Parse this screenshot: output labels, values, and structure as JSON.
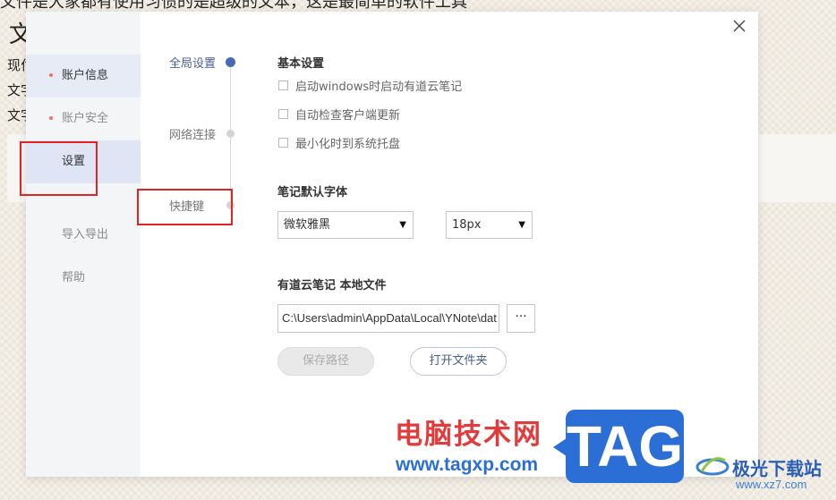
{
  "background": {
    "top_text": "文件是大家都有使用习惯的是超级的文本，这是最简单的软件工具",
    "heading": "文",
    "lines": [
      "现付",
      "文字",
      "文字"
    ]
  },
  "sidebar": {
    "items": [
      {
        "label": "账户信息"
      },
      {
        "label": "账户安全"
      },
      {
        "label": "设置"
      },
      {
        "label": "导入导出"
      },
      {
        "label": "帮助"
      }
    ]
  },
  "settings_nav": {
    "items": [
      {
        "label": "全局设置"
      },
      {
        "label": "网络连接"
      },
      {
        "label": "快捷键"
      }
    ]
  },
  "basic": {
    "title": "基本设置",
    "options": [
      {
        "label": "启动windows时启动有道云笔记",
        "checked": false
      },
      {
        "label": "自动检查客户端更新",
        "checked": false
      },
      {
        "label": "最小化时到系统托盘",
        "checked": false
      }
    ]
  },
  "font": {
    "title": "笔记默认字体",
    "family_value": "微软雅黑",
    "size_value": "18px"
  },
  "storage": {
    "title": "有道云笔记  本地文件",
    "path_value": "C:\\Users\\admin\\AppData\\Local\\YNote\\dat",
    "browse_label": "···",
    "save_label": "保存路径",
    "open_label": "打开文件夹"
  },
  "watermark": {
    "cn_text": "电脑技术网",
    "url_text": "www.tagxp.com",
    "tag_text": "TAG",
    "site_text": "极光下载站",
    "site_url": "www.xz7.com"
  },
  "colors": {
    "accent": "#4a69b7",
    "highlight": "#e02424",
    "sidebar_bg": "#f4f5f7",
    "watermark_red": "#e33b3b",
    "watermark_blue": "#2b6fd6"
  }
}
